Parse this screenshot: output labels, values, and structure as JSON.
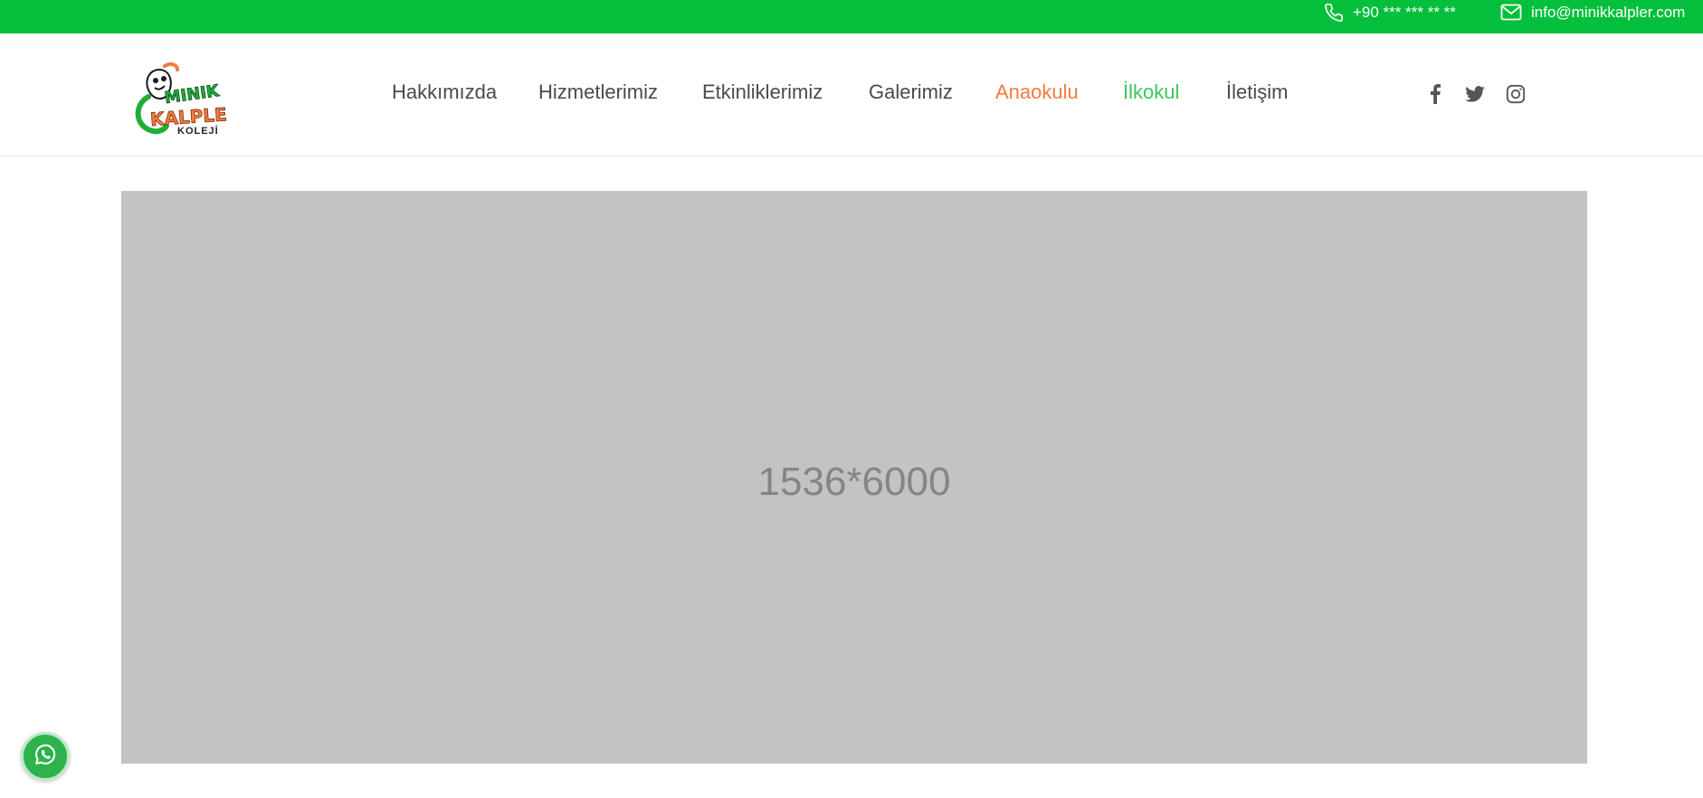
{
  "topbar": {
    "phone": "+90 *** *** ** **",
    "phone_icon": "phone-icon",
    "email": "info@minikkalpler.com",
    "email_icon": "envelope-icon",
    "background_color": "#04bf3b"
  },
  "brand": {
    "logo_line1": "MINIK",
    "logo_line2": "KALPLER",
    "logo_line3": "KOLEJİ"
  },
  "nav": {
    "items": [
      {
        "label": "Hakkımızda"
      },
      {
        "label": "Hizmetlerimiz"
      },
      {
        "label": "Etkinliklerimiz"
      },
      {
        "label": "Galerimiz"
      },
      {
        "label": "Anaokulu",
        "color": "#f07c3e"
      },
      {
        "label": "İlkokul",
        "color": "#3cc65a"
      },
      {
        "label": "İletişim"
      }
    ]
  },
  "social": {
    "icons": [
      "facebook-icon",
      "twitter-icon",
      "instagram-icon"
    ]
  },
  "banner": {
    "placeholder_text": "1536*6000",
    "background_color": "#c3c3c3"
  },
  "floating": {
    "whatsapp_icon": "whatsapp-icon",
    "color": "#2db34c"
  }
}
